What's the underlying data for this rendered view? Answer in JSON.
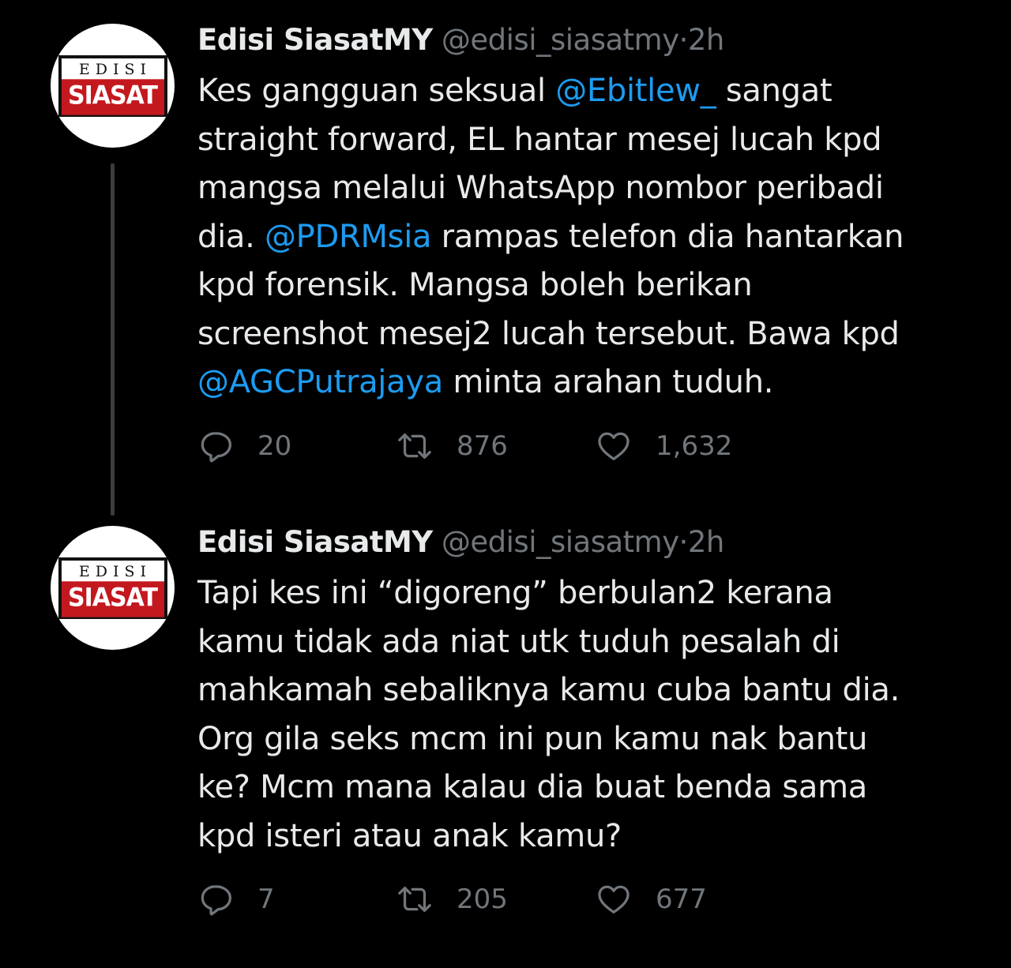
{
  "tweets": [
    {
      "avatar": {
        "top_text": "EDISI",
        "bottom_text": "SIASAT"
      },
      "display_name": "Edisi SiasatMY",
      "handle": "@edisi_siasatmy",
      "separator": "·",
      "time": "2h",
      "text_segments": [
        {
          "text": "Kes gangguan seksual ",
          "type": "text"
        },
        {
          "text": "@Ebitlew_",
          "type": "mention"
        },
        {
          "text": " sangat\nstraight forward, EL hantar mesej lucah kpd\nmangsa melalui WhatsApp nombor peribadi\ndia. ",
          "type": "text"
        },
        {
          "text": "@PDRMsia",
          "type": "mention"
        },
        {
          "text": " rampas telefon dia hantarkan\nkpd forensik. Mangsa boleh berikan\nscreenshot mesej2 lucah tersebut. Bawa kpd\n",
          "type": "text"
        },
        {
          "text": "@AGCPutrajaya",
          "type": "mention"
        },
        {
          "text": " minta arahan tuduh.",
          "type": "text"
        }
      ],
      "replies": "20",
      "retweets": "876",
      "likes": "1,632"
    },
    {
      "avatar": {
        "top_text": "EDISI",
        "bottom_text": "SIASAT"
      },
      "display_name": "Edisi SiasatMY",
      "handle": "@edisi_siasatmy",
      "separator": "·",
      "time": "2h",
      "text_segments": [
        {
          "text": "Tapi kes ini “digoreng” berbulan2 kerana\nkamu tidak ada niat utk tuduh pesalah di\nmahkamah sebaliknya kamu cuba bantu dia.\nOrg gila seks mcm ini pun kamu nak bantu\nke? Mcm mana kalau dia buat benda sama\nkpd isteri atau anak kamu?",
          "type": "text"
        }
      ],
      "replies": "7",
      "retweets": "205",
      "likes": "677"
    }
  ],
  "colors": {
    "background": "#000000",
    "text": "#e7e9ea",
    "secondary": "#71767b",
    "mention": "#1d9bf0",
    "logo_red": "#c4181f",
    "thread_line": "#3a3d40"
  },
  "icons": {
    "reply": "reply-icon",
    "retweet": "retweet-icon",
    "like": "heart-icon"
  }
}
